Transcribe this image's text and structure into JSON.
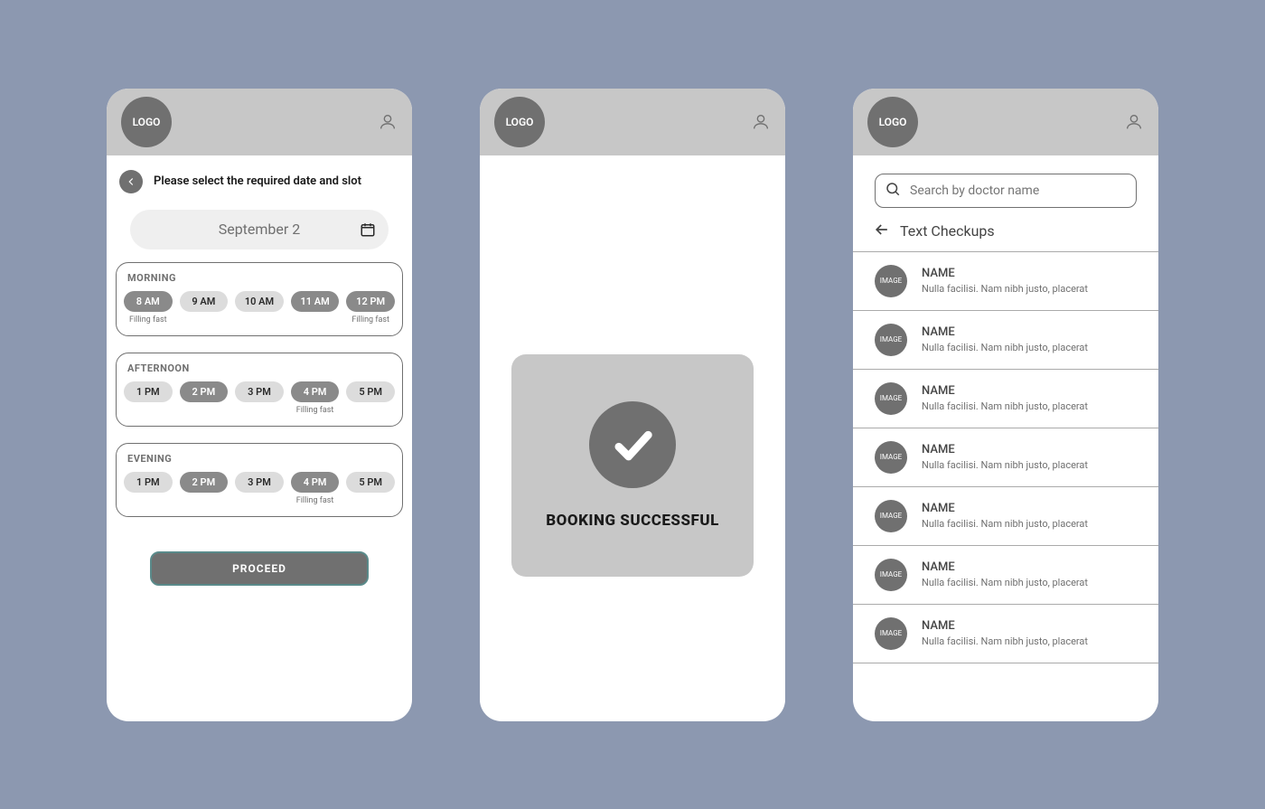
{
  "logo_text": "LOGO",
  "screen1": {
    "header_title": "Please select the required date and slot",
    "selected_date": "September 2",
    "proceed_label": "PROCEED",
    "groups": [
      {
        "title": "MORNING",
        "slots": [
          {
            "label": "8 AM",
            "selected": true,
            "note": "Filling fast"
          },
          {
            "label": "9 AM",
            "selected": false,
            "note": ""
          },
          {
            "label": "10 AM",
            "selected": false,
            "note": ""
          },
          {
            "label": "11 AM",
            "selected": true,
            "note": ""
          },
          {
            "label": "12 PM",
            "selected": true,
            "note": "Filling fast"
          }
        ]
      },
      {
        "title": "AFTERNOON",
        "slots": [
          {
            "label": "1 PM",
            "selected": false,
            "note": ""
          },
          {
            "label": "2 PM",
            "selected": true,
            "note": ""
          },
          {
            "label": "3 PM",
            "selected": false,
            "note": ""
          },
          {
            "label": "4 PM",
            "selected": true,
            "note": "Filling fast"
          },
          {
            "label": "5 PM",
            "selected": false,
            "note": ""
          }
        ]
      },
      {
        "title": "EVENING",
        "slots": [
          {
            "label": "1 PM",
            "selected": false,
            "note": ""
          },
          {
            "label": "2 PM",
            "selected": true,
            "note": ""
          },
          {
            "label": "3 PM",
            "selected": false,
            "note": ""
          },
          {
            "label": "4 PM",
            "selected": true,
            "note": "Filling fast"
          },
          {
            "label": "5 PM",
            "selected": false,
            "note": ""
          }
        ]
      }
    ]
  },
  "screen2": {
    "success_message": "BOOKING SUCCESSFUL"
  },
  "screen3": {
    "search_placeholder": "Search by doctor name",
    "back_label": "Text Checkups",
    "avatar_text": "IMAGE",
    "doctors": [
      {
        "name": "NAME",
        "desc": "Nulla facilisi. Nam nibh justo, placerat"
      },
      {
        "name": "NAME",
        "desc": "Nulla facilisi. Nam nibh justo, placerat"
      },
      {
        "name": "NAME",
        "desc": "Nulla facilisi. Nam nibh justo, placerat"
      },
      {
        "name": "NAME",
        "desc": "Nulla facilisi. Nam nibh justo, placerat"
      },
      {
        "name": "NAME",
        "desc": "Nulla facilisi. Nam nibh justo, placerat"
      },
      {
        "name": "NAME",
        "desc": "Nulla facilisi. Nam nibh justo, placerat"
      },
      {
        "name": "NAME",
        "desc": "Nulla facilisi. Nam nibh justo, placerat"
      }
    ]
  }
}
